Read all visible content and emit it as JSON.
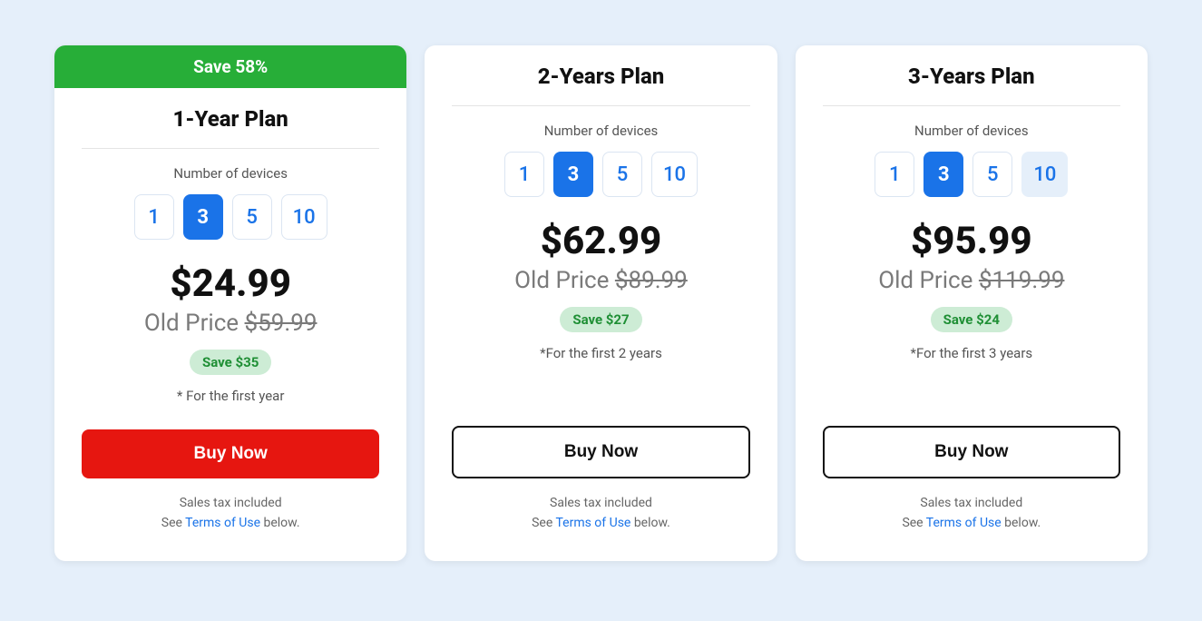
{
  "common": {
    "devices_label": "Number of devices",
    "old_price_label": "Old Price ",
    "buy_label": "Buy Now",
    "tax_line": "Sales tax included",
    "see_prefix": "See ",
    "terms_link": "Terms of Use",
    "see_suffix": " below."
  },
  "plans": [
    {
      "banner": "Save 58%",
      "show_banner": true,
      "title": "1-Year Plan",
      "device_options": [
        "1",
        "3",
        "5",
        "10"
      ],
      "selected_index": 1,
      "hover_index": -1,
      "price": "$24.99",
      "old_price": "$59.99",
      "save": "Save $35",
      "note": "* For the first year",
      "primary": true
    },
    {
      "banner": "",
      "show_banner": false,
      "title": "2-Years Plan",
      "device_options": [
        "1",
        "3",
        "5",
        "10"
      ],
      "selected_index": 1,
      "hover_index": -1,
      "price": "$62.99",
      "old_price": "$89.99",
      "save": "Save $27",
      "note": "*For the first 2 years",
      "primary": false
    },
    {
      "banner": "",
      "show_banner": false,
      "title": "3-Years Plan",
      "device_options": [
        "1",
        "3",
        "5",
        "10"
      ],
      "selected_index": 1,
      "hover_index": 3,
      "price": "$95.99",
      "old_price": "$119.99",
      "save": "Save $24",
      "note": "*For the first 3 years",
      "primary": false
    }
  ]
}
